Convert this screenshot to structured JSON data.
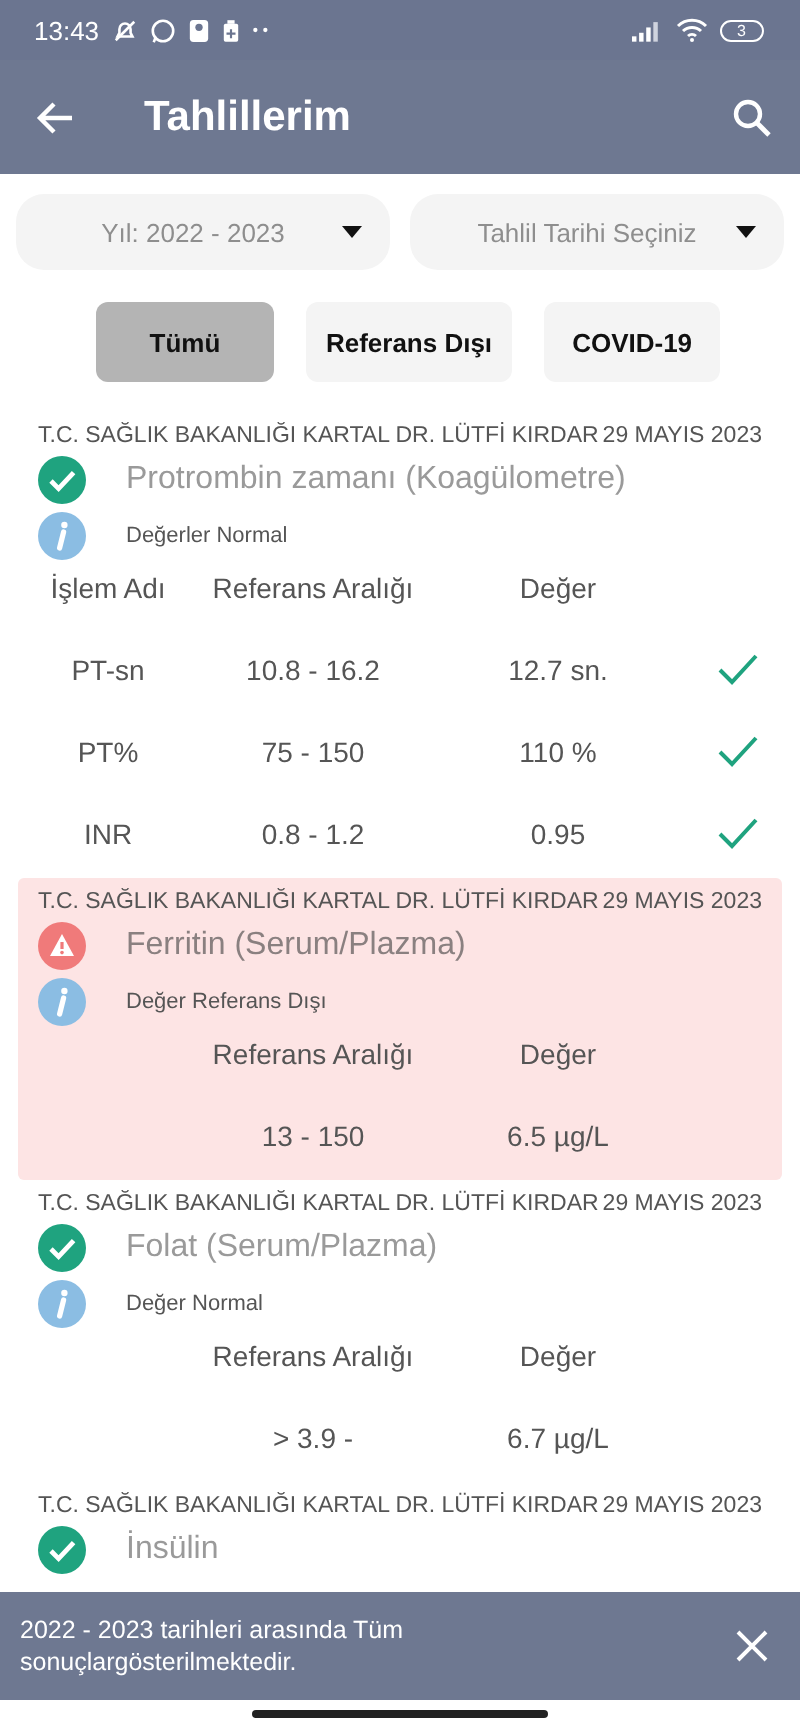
{
  "status_bar": {
    "time": "13:43",
    "battery": "3"
  },
  "app_bar": {
    "title": "Tahlillerim"
  },
  "filters": [
    {
      "placeholder": "Yıl: 2022 - 2023"
    },
    {
      "placeholder": "Tahlil Tarihi Seçiniz"
    }
  ],
  "tabs": [
    {
      "label": "Tümü",
      "selected": true
    },
    {
      "label": "Referans Dışı",
      "selected": false
    },
    {
      "label": "COVID-19",
      "selected": false
    }
  ],
  "results": [
    {
      "hospital": "T.C. SAĞLIK BAKANLIĞI KARTAL DR. LÜTFİ KIRDAR",
      "date": "29 MAYIS 2023",
      "test": "Protrombin zamanı (Koagülometre)",
      "kind": "normal",
      "note": "Değerler Normal",
      "columns": [
        {
          "kind": "name",
          "label": "İşlem Adı"
        },
        {
          "kind": "range",
          "label": "Referans Aralığı"
        },
        {
          "kind": "value",
          "label": "Değer"
        }
      ],
      "rows": [
        {
          "name": "PT-sn",
          "range": "10.8 - 16.2",
          "value": "12.7 sn.",
          "checked": true
        },
        {
          "name": "PT%",
          "range": "75 - 150",
          "value": "110 %",
          "checked": true
        },
        {
          "name": "INR",
          "range": "0.8 - 1.2",
          "value": "0.95",
          "checked": true
        }
      ]
    },
    {
      "hospital": "T.C. SAĞLIK BAKANLIĞI KARTAL DR. LÜTFİ KIRDAR",
      "date": "29 MAYIS 2023",
      "test": "Ferritin (Serum/Plazma)",
      "kind": "warning",
      "note": "Değer Referans Dışı",
      "columns": [
        {
          "kind": "range",
          "label": "Referans Aralığı"
        },
        {
          "kind": "value",
          "label": "Değer"
        }
      ],
      "rows": [
        {
          "range": "13 - 150",
          "value": "6.5 µg/L"
        }
      ]
    },
    {
      "hospital": "T.C. SAĞLIK BAKANLIĞI KARTAL DR. LÜTFİ KIRDAR",
      "date": "29 MAYIS 2023",
      "test": "Folat (Serum/Plazma)",
      "kind": "normal",
      "note": "Değer Normal",
      "columns": [
        {
          "kind": "range",
          "label": "Referans Aralığı"
        },
        {
          "kind": "value",
          "label": "Değer"
        }
      ],
      "rows": [
        {
          "range": "> 3.9 -",
          "value": "6.7 µg/L"
        }
      ]
    },
    {
      "hospital": "T.C. SAĞLIK BAKANLIĞI KARTAL DR. LÜTFİ KIRDAR",
      "date": "29 MAYIS 2023",
      "test": "İnsülin",
      "kind": "normal"
    }
  ],
  "snackbar": {
    "message": "2022 - 2023 tarihleri arasında Tüm sonuçlargösterilmektedir."
  }
}
